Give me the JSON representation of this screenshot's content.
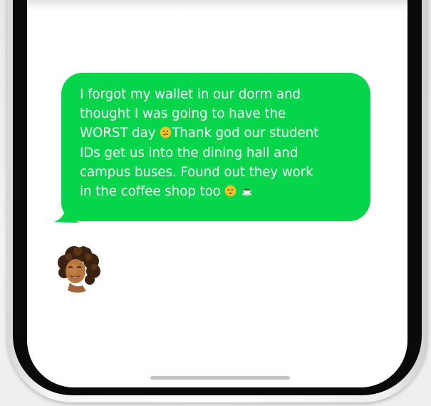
{
  "message": {
    "line1": "I forgot my wallet in our dorm and",
    "line2": "thought I was going to have the",
    "line3a": "WORST day ",
    "line3b": "Thank god our student",
    "line4": "IDs get us into the dining hall and",
    "line5": "campus buses. Found out they work",
    "line6": "in the coffee shop too ",
    "emojis": [
      "confused-face-emoji",
      "relieved-face-emoji",
      "coffee-cup-emoji"
    ]
  },
  "colors": {
    "bubble": "#05d54a",
    "text": "#ffffff",
    "home_indicator": "#c4c4c4"
  }
}
